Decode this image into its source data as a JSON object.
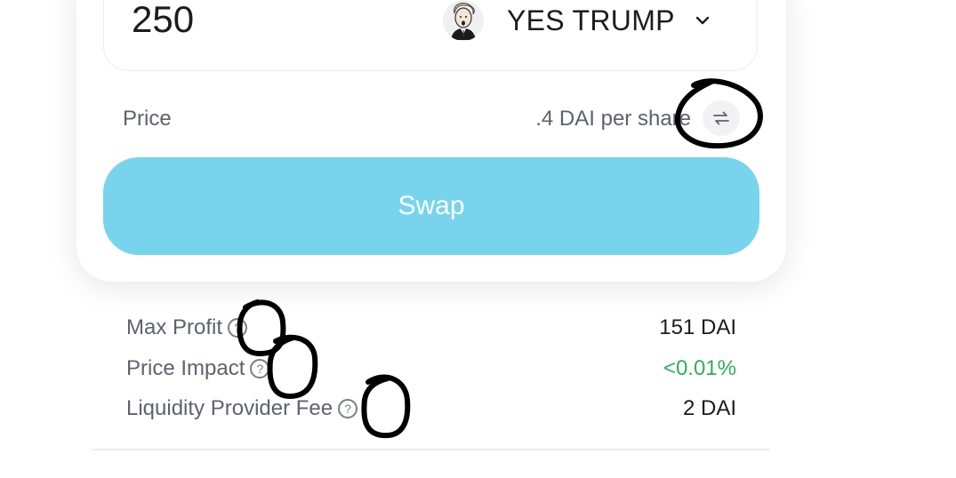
{
  "swap_form": {
    "amount": "250",
    "token": {
      "label": "YES TRUMP",
      "avatar_icon": "trump-avatar-icon",
      "dropdown_icon": "chevron-down-icon"
    },
    "price": {
      "label": "Price",
      "value": ".4 DAI per share",
      "toggle_icon": "swap-arrows-icon"
    },
    "swap_button_label": "Swap"
  },
  "details": [
    {
      "label": "Max Profit",
      "value": "151 DAI",
      "value_color": "#1c1c1e",
      "help_icon": "question-mark-icon",
      "help_glyph": "?"
    },
    {
      "label": "Price Impact",
      "value": "<0.01%",
      "value_color": "#2fae5a",
      "help_icon": "question-mark-icon",
      "help_glyph": "?"
    },
    {
      "label": "Liquidity Provider Fee",
      "value": "2 DAI",
      "value_color": "#1c1c1e",
      "help_icon": "question-mark-icon",
      "help_glyph": "?"
    }
  ],
  "colors": {
    "swap_button": "#77d4ec",
    "positive": "#2fae5a",
    "annotation_ink": "#000000"
  }
}
